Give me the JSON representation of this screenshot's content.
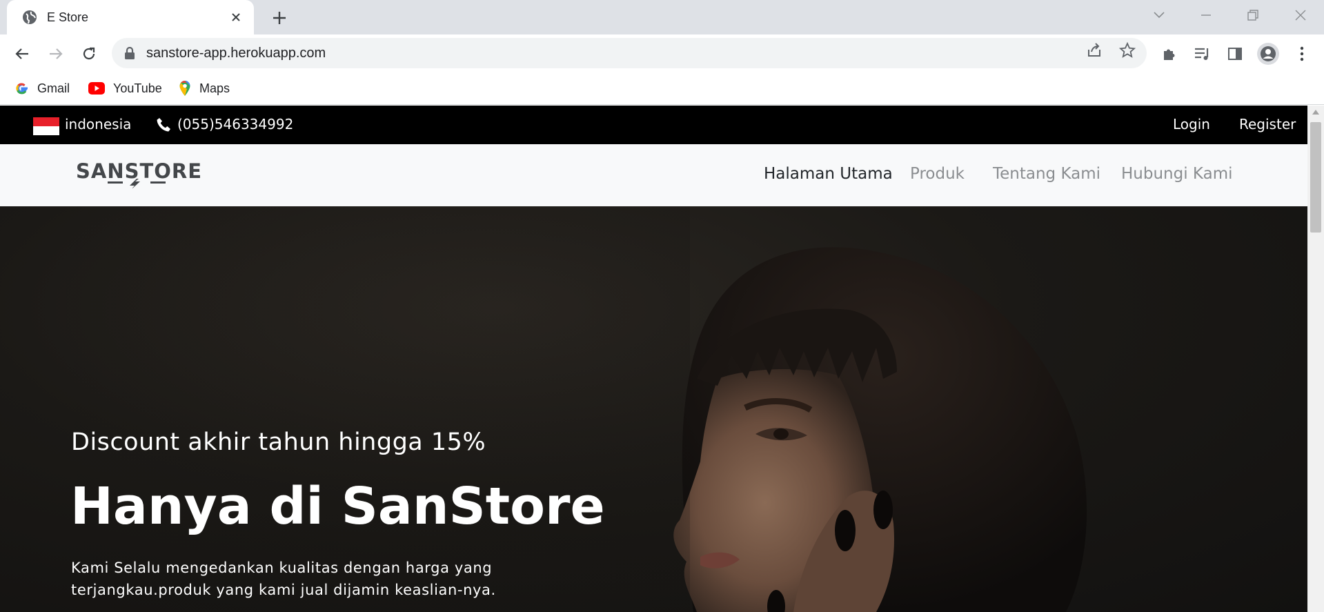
{
  "browser": {
    "tab_title": "E Store",
    "url": "sanstore-app.herokuapp.com",
    "bookmarks": [
      {
        "label": "Gmail",
        "icon": "gmail-icon"
      },
      {
        "label": "YouTube",
        "icon": "youtube-icon"
      },
      {
        "label": "Maps",
        "icon": "maps-icon"
      }
    ]
  },
  "topbar": {
    "country": "indonesia",
    "phone": "(055)546334992",
    "login": "Login",
    "register": "Register"
  },
  "nav": {
    "logo": "SANSTORE",
    "items": [
      "Halaman Utama",
      "Produk",
      "Tentang Kami",
      "Hubungi Kami"
    ],
    "active": "Halaman Utama"
  },
  "hero": {
    "subtitle": "Discount akhir tahun hingga 15%",
    "title": "Hanya di SanStore",
    "description": "Kami Selalu mengedankan kualitas dengan harga yang terjangkau.produk yang kami jual dijamin keaslian-nya."
  },
  "colors": {
    "topbar_bg": "#000000",
    "nav_bg": "#f8f9fa",
    "hero_bg": "#1b1916"
  }
}
